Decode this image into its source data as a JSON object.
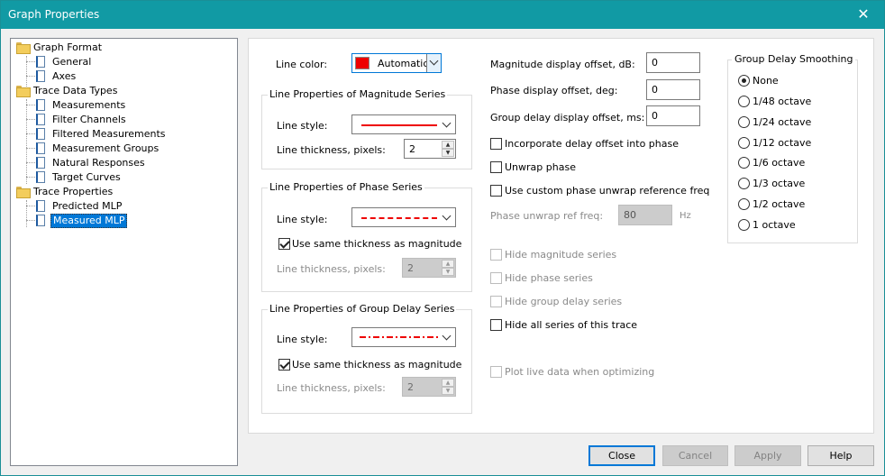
{
  "window": {
    "title": "Graph Properties"
  },
  "tree": {
    "items": [
      {
        "label": "Graph Format",
        "type": "folder"
      },
      {
        "label": "General",
        "type": "doc"
      },
      {
        "label": "Axes",
        "type": "doc"
      },
      {
        "label": "Trace Data Types",
        "type": "folder"
      },
      {
        "label": "Measurements",
        "type": "doc"
      },
      {
        "label": "Filter Channels",
        "type": "doc"
      },
      {
        "label": "Filtered Measurements",
        "type": "doc"
      },
      {
        "label": "Measurement Groups",
        "type": "doc"
      },
      {
        "label": "Natural Responses",
        "type": "doc"
      },
      {
        "label": "Target Curves",
        "type": "doc"
      },
      {
        "label": "Trace Properties",
        "type": "folder"
      },
      {
        "label": "Predicted MLP",
        "type": "doc"
      },
      {
        "label": "Measured MLP",
        "type": "doc",
        "selected": true
      }
    ]
  },
  "line_color": {
    "label": "Line color:",
    "value": "Automatic",
    "swatch_color": "#ee0000"
  },
  "magnitude_group": {
    "title": "Line Properties of Magnitude Series",
    "style_label": "Line style:",
    "style": "solid",
    "thickness_label": "Line thickness, pixels:",
    "thickness": "2"
  },
  "phase_group": {
    "title": "Line Properties of Phase Series",
    "style_label": "Line style:",
    "style": "dashed",
    "same_label": "Use same thickness as magnitude",
    "same_checked": true,
    "thickness_label": "Line thickness, pixels:",
    "thickness": "2"
  },
  "delay_group": {
    "title": "Line Properties of Group Delay Series",
    "style_label": "Line style:",
    "style": "dash-dot",
    "same_label": "Use same thickness as magnitude",
    "same_checked": true,
    "thickness_label": "Line thickness, pixels:",
    "thickness": "2"
  },
  "offsets": {
    "magnitude_label": "Magnitude display offset, dB:",
    "magnitude_value": "0",
    "phase_label": "Phase display offset, deg:",
    "phase_value": "0",
    "delay_label": "Group delay display offset, ms:",
    "delay_value": "0"
  },
  "options": {
    "incorporate_delay": "Incorporate delay offset into phase",
    "unwrap_phase": "Unwrap phase",
    "custom_unwrap": "Use custom phase unwrap reference freq",
    "unwrap_ref_label": "Phase unwrap ref freq:",
    "unwrap_ref_value": "80",
    "unwrap_ref_unit": "Hz",
    "hide_magnitude": "Hide magnitude series",
    "hide_phase": "Hide phase series",
    "hide_delay": "Hide group delay series",
    "hide_all": "Hide all series of this trace",
    "plot_live": "Plot live data when optimizing"
  },
  "smoothing": {
    "title": "Group Delay Smoothing",
    "options": [
      "None",
      "1/48 octave",
      "1/24 octave",
      "1/12 octave",
      "1/6 octave",
      "1/3 octave",
      "1/2 octave",
      "1 octave"
    ],
    "selected": "None"
  },
  "buttons": {
    "close": "Close",
    "cancel": "Cancel",
    "apply": "Apply",
    "help": "Help"
  },
  "colors": {
    "titlebar": "#119aa4",
    "selection": "#0078d7",
    "line_red": "#ee0000"
  }
}
